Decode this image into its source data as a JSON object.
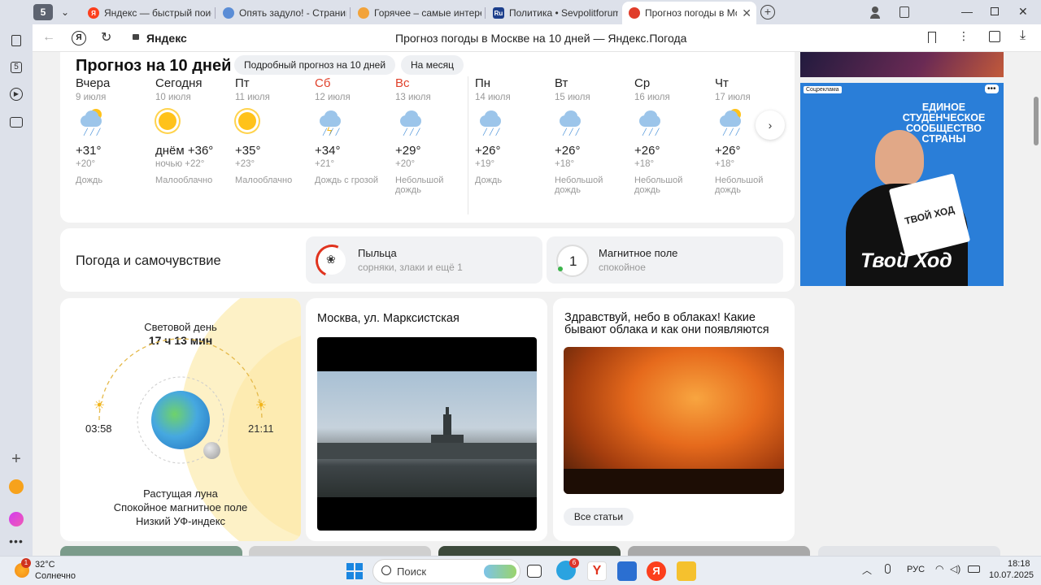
{
  "browser": {
    "tab_count": "5",
    "tabs": [
      {
        "title": "Яндекс — быстрый поиск в интернете",
        "favicon": "yandex-icon",
        "color": "#fc3f1d"
      },
      {
        "title": "Опять задуло! - Страница",
        "favicon": "forum-icon",
        "color": "#5b8dd6"
      },
      {
        "title": "Горячее – самые интересные",
        "favicon": "pikabu-icon",
        "color": "#f2a33a"
      },
      {
        "title": "Политика • Sevpolitforum",
        "favicon": "ru-icon",
        "color": "#1d3f8c",
        "favicon_text": "Ru"
      },
      {
        "title": "Прогноз погоды в Москве",
        "favicon": "yandex-weather-icon",
        "color": "#e03d2a"
      }
    ],
    "address": {
      "site": "Яндекс",
      "page_title": "Прогноз погоды в Москве на 10 дней — Яндекс.Погода"
    }
  },
  "forecast": {
    "title": "Прогноз на 10 дней",
    "detailed_label": "Подробный прогноз на 10 дней",
    "month_label": "На месяц",
    "days": [
      {
        "name": "Вчера",
        "date": "9 июля",
        "icon": "cloud-sun-rain-icon",
        "max": "+31°",
        "min": "+20°",
        "cond": "Дождь",
        "weekend": false
      },
      {
        "name": "Сегодня",
        "date": "10 июля",
        "icon": "sun-icon",
        "max": "днём +36°",
        "min": "ночью +22°",
        "cond": "Малооблачно",
        "weekend": false
      },
      {
        "name": "Пт",
        "date": "11 июля",
        "icon": "sun-icon",
        "max": "+35°",
        "min": "+23°",
        "cond": "Малооблачно",
        "weekend": false
      },
      {
        "name": "Сб",
        "date": "12 июля",
        "icon": "thunderstorm-icon",
        "max": "+34°",
        "min": "+21°",
        "cond": "Дождь с грозой",
        "weekend": true
      },
      {
        "name": "Вс",
        "date": "13 июля",
        "icon": "light-rain-icon",
        "max": "+29°",
        "min": "+20°",
        "cond": "Небольшой дождь",
        "weekend": true
      },
      {
        "name": "Пн",
        "date": "14 июля",
        "icon": "rain-icon",
        "max": "+26°",
        "min": "+19°",
        "cond": "Дождь",
        "weekend": false
      },
      {
        "name": "Вт",
        "date": "15 июля",
        "icon": "light-rain-icon",
        "max": "+26°",
        "min": "+18°",
        "cond": "Небольшой дождь",
        "weekend": false
      },
      {
        "name": "Ср",
        "date": "16 июля",
        "icon": "light-rain-icon",
        "max": "+26°",
        "min": "+18°",
        "cond": "Небольшой дождь",
        "weekend": false
      },
      {
        "name": "Чт",
        "date": "17 июля",
        "icon": "cloud-sun-rain-icon",
        "max": "+26°",
        "min": "+18°",
        "cond": "Небольшой дождь",
        "weekend": false
      }
    ]
  },
  "wellbeing": {
    "title": "Погода и самочувствие",
    "pollen": {
      "title": "Пыльца",
      "subtitle": "сорняки, злаки и ещё 1"
    },
    "magnetic": {
      "value": "1",
      "title": "Магнитное поле",
      "subtitle": "спокойное"
    }
  },
  "daylight": {
    "label": "Световой день",
    "duration": "17 ч 13 мин",
    "sunrise": "03:58",
    "sunset": "21:11",
    "lines": [
      "Растущая луна",
      "Спокойное магнитное поле",
      "Низкий УФ-индекс"
    ]
  },
  "camera": {
    "title": "Москва, ул. Марксистская"
  },
  "article": {
    "title": "Здравствуй, небо в облаках! Какие бывают облака и как они появляются",
    "button": "Все статьи"
  },
  "ad": {
    "label": "Соцреклама",
    "headline": "ЕДИНОЕ СТУДЕНЧЕСКОЕ СООБЩЕСТВО СТРАНЫ",
    "brand": "Твой Ход",
    "book_text": "ТВОЙ ХОД"
  },
  "taskbar": {
    "weather_temp": "32°C",
    "weather_desc": "Солнечно",
    "weather_badge": "1",
    "search_placeholder": "Поиск",
    "telegram_badge": "6",
    "lang": "РУС",
    "time": "18:18",
    "date": "10.07.2025"
  }
}
